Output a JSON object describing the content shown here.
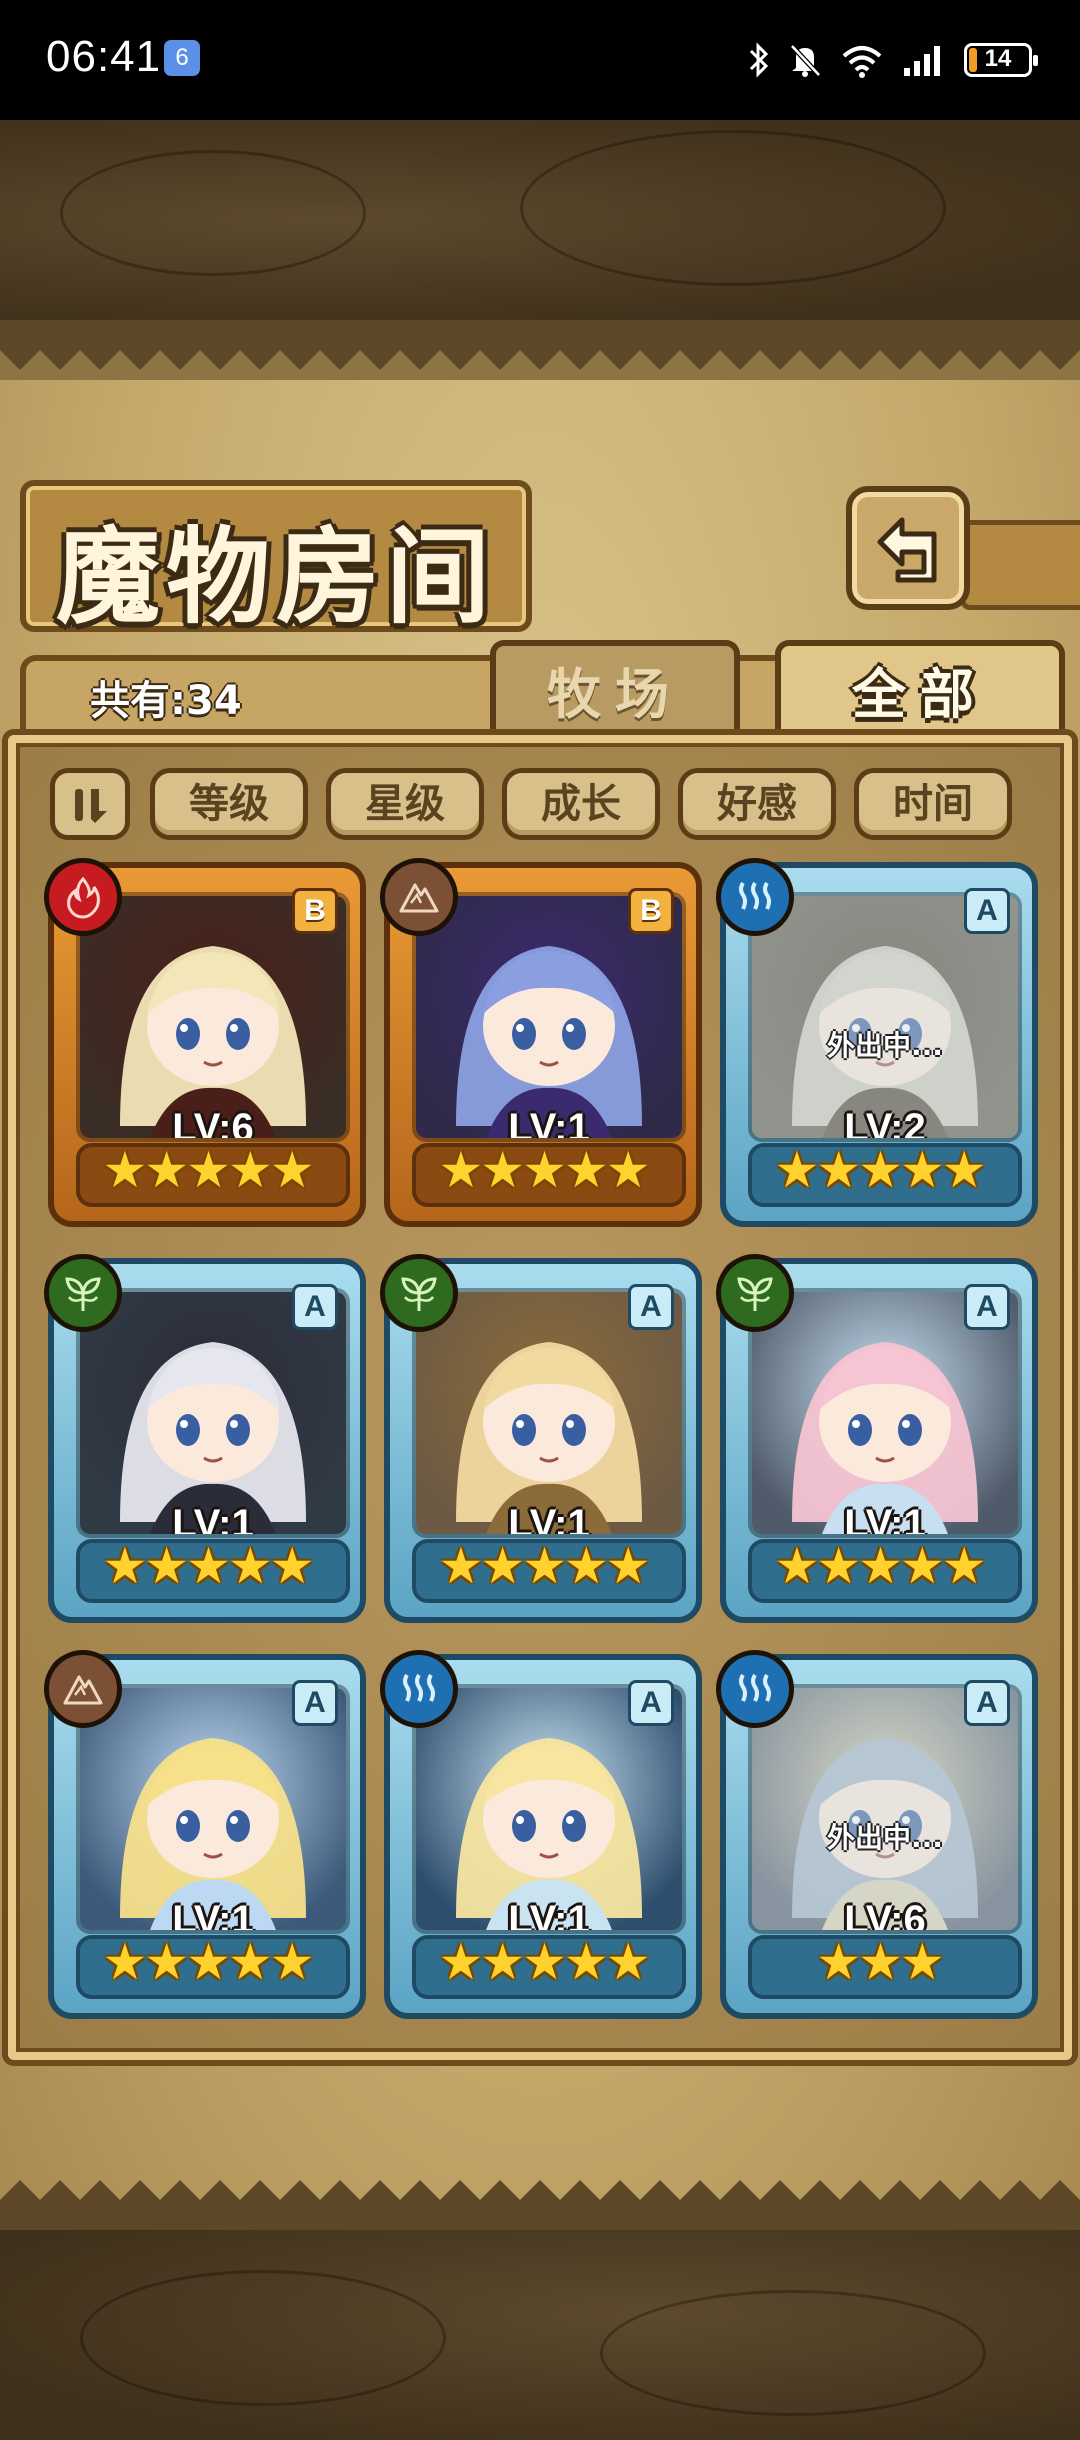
{
  "status": {
    "time": "06:41",
    "app_badge": "6",
    "battery": "14",
    "battery_level": 0.14,
    "icons": [
      "bluetooth-icon",
      "mute-bell-icon",
      "wifi-icon",
      "signal-icon"
    ]
  },
  "header": {
    "title": "魔物房间"
  },
  "summary": {
    "count_label": "共有:34"
  },
  "tabs": [
    {
      "label": "牧场",
      "active": false
    },
    {
      "label": "全部",
      "active": true
    }
  ],
  "sort_buttons": [
    "等级",
    "星级",
    "成长",
    "好感",
    "时间"
  ],
  "monsters": [
    {
      "element": "fire",
      "grade": "B",
      "level": "LV:6",
      "stars": 5,
      "rarity": "gold",
      "status": ""
    },
    {
      "element": "earth",
      "grade": "B",
      "level": "LV:1",
      "stars": 5,
      "rarity": "gold",
      "status": ""
    },
    {
      "element": "water",
      "grade": "A",
      "level": "LV:2",
      "stars": 5,
      "rarity": "blue",
      "status": "外出中..."
    },
    {
      "element": "plant",
      "grade": "A",
      "level": "LV:1",
      "stars": 5,
      "rarity": "blue",
      "status": ""
    },
    {
      "element": "plant",
      "grade": "A",
      "level": "LV:1",
      "stars": 5,
      "rarity": "blue",
      "status": ""
    },
    {
      "element": "plant",
      "grade": "A",
      "level": "LV:1",
      "stars": 5,
      "rarity": "blue",
      "status": ""
    },
    {
      "element": "earth",
      "grade": "A",
      "level": "LV:1",
      "stars": 5,
      "rarity": "blue",
      "status": ""
    },
    {
      "element": "water",
      "grade": "A",
      "level": "LV:1",
      "stars": 5,
      "rarity": "blue",
      "status": ""
    },
    {
      "element": "water",
      "grade": "A",
      "level": "LV:6",
      "stars": 3,
      "rarity": "blue",
      "status": "外出中..."
    }
  ],
  "colors": {
    "gold_frame": "#e99a35",
    "blue_frame": "#a9dcee",
    "fire": "#c51b21",
    "earth": "#7b5034",
    "water": "#1f6fb3",
    "plant": "#2f6b1e",
    "star": "#ffd22e"
  }
}
